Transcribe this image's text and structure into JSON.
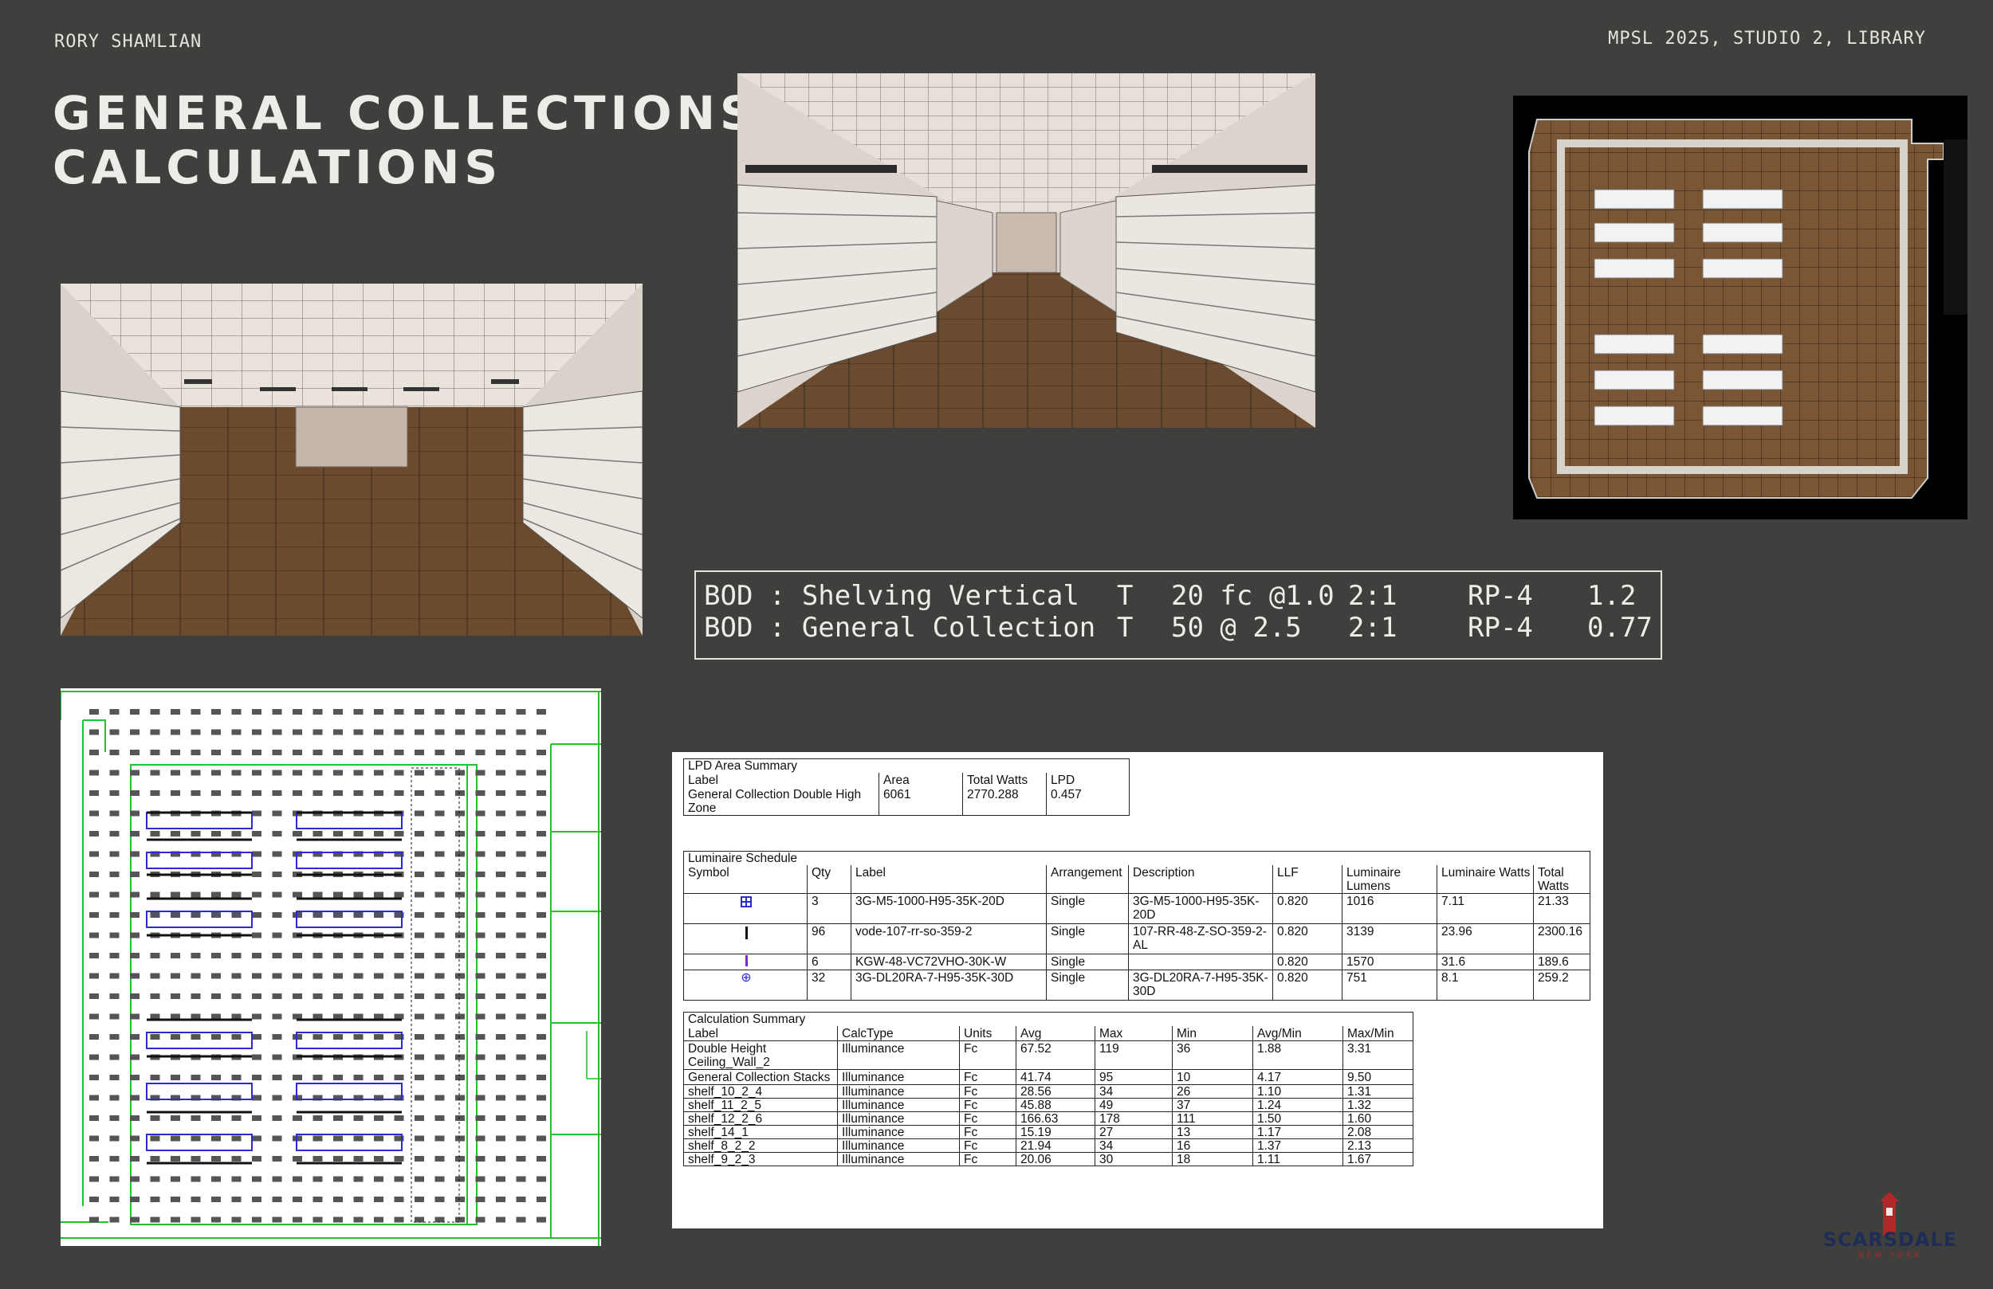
{
  "header": {
    "author": "RORY SHAMLIAN",
    "project": "MPSL 2025, STUDIO 2, LIBRARY",
    "title_line1": "GENERAL COLLECTIONS",
    "title_line2": "CALCULATIONS"
  },
  "bod": {
    "rows": [
      {
        "label": "BOD : Shelving Vertical",
        "t": "T",
        "target": "20 fc @1.0",
        "ratio": "2:1",
        "fixture": "RP-4",
        "value": "1.2"
      },
      {
        "label": "BOD : General Collection",
        "t": "T",
        "target": "50 @ 2.5",
        "ratio": "2:1",
        "fixture": "RP-4",
        "value": "0.77"
      }
    ]
  },
  "lpd_summary": {
    "caption": "LPD Area Summary",
    "headers": [
      "Label",
      "Area",
      "Total Watts",
      "LPD"
    ],
    "row": {
      "label": "General Collection Double High Zone",
      "area": "6061",
      "watts": "2770.288",
      "lpd": "0.457"
    }
  },
  "luminaire_schedule": {
    "caption": "Luminaire Schedule",
    "headers": [
      "Symbol",
      "Qty",
      "Label",
      "Arrangement",
      "Description",
      "LLF",
      "Luminaire Lumens",
      "Luminaire Watts",
      "Total Watts"
    ],
    "rows": [
      {
        "qty": "3",
        "label": "3G-M5-1000-H95-35K-20D",
        "arr": "Single",
        "desc": "3G-M5-1000-H95-35K-20D",
        "llf": "0.820",
        "lumens": "1016",
        "watts": "7.11",
        "total": "21.33"
      },
      {
        "qty": "96",
        "label": "vode-107-rr-so-359-2",
        "arr": "Single",
        "desc": "107-RR-48-Z-SO-359-2-AL",
        "llf": "0.820",
        "lumens": "3139",
        "watts": "23.96",
        "total": "2300.16"
      },
      {
        "qty": "6",
        "label": "KGW-48-VC72VHO-30K-W",
        "arr": "Single",
        "desc": "",
        "llf": "0.820",
        "lumens": "1570",
        "watts": "31.6",
        "total": "189.6"
      },
      {
        "qty": "32",
        "label": "3G-DL20RA-7-H95-35K-30D",
        "arr": "Single",
        "desc": "3G-DL20RA-7-H95-35K-30D",
        "llf": "0.820",
        "lumens": "751",
        "watts": "8.1",
        "total": "259.2"
      }
    ]
  },
  "calc_summary": {
    "caption": "Calculation Summary",
    "headers": [
      "Label",
      "CalcType",
      "Units",
      "Avg",
      "Max",
      "Min",
      "Avg/Min",
      "Max/Min"
    ],
    "rows": [
      {
        "label": "Double Height Ceiling_Wall_2",
        "type": "Illuminance",
        "units": "Fc",
        "avg": "67.52",
        "max": "119",
        "min": "36",
        "avgmin": "1.88",
        "maxmin": "3.31"
      },
      {
        "label": "General Collection Stacks",
        "type": "Illuminance",
        "units": "Fc",
        "avg": "41.74",
        "max": "95",
        "min": "10",
        "avgmin": "4.17",
        "maxmin": "9.50"
      },
      {
        "label": "shelf_10_2_4",
        "type": "Illuminance",
        "units": "Fc",
        "avg": "28.56",
        "max": "34",
        "min": "26",
        "avgmin": "1.10",
        "maxmin": "1.31"
      },
      {
        "label": "shelf_11_2_5",
        "type": "Illuminance",
        "units": "Fc",
        "avg": "45.88",
        "max": "49",
        "min": "37",
        "avgmin": "1.24",
        "maxmin": "1.32"
      },
      {
        "label": "shelf_12_2_6",
        "type": "Illuminance",
        "units": "Fc",
        "avg": "166.63",
        "max": "178",
        "min": "111",
        "avgmin": "1.50",
        "maxmin": "1.60"
      },
      {
        "label": "shelf_14_1",
        "type": "Illuminance",
        "units": "Fc",
        "avg": "15.19",
        "max": "27",
        "min": "13",
        "avgmin": "1.17",
        "maxmin": "2.08"
      },
      {
        "label": "shelf_8_2_2",
        "type": "Illuminance",
        "units": "Fc",
        "avg": "21.94",
        "max": "34",
        "min": "16",
        "avgmin": "1.37",
        "maxmin": "2.13"
      },
      {
        "label": "shelf_9_2_3",
        "type": "Illuminance",
        "units": "Fc",
        "avg": "20.06",
        "max": "30",
        "min": "18",
        "avgmin": "1.11",
        "maxmin": "1.67"
      }
    ]
  },
  "logo": {
    "word": "SCARSDALE",
    "sub": "NEW YORK"
  },
  "colors": {
    "background": "#3f3f3d",
    "accent_blue": "#2b2bd0",
    "grid_green": "#22c22a",
    "logo_red": "#b3262a",
    "logo_navy": "#1d2d55"
  }
}
